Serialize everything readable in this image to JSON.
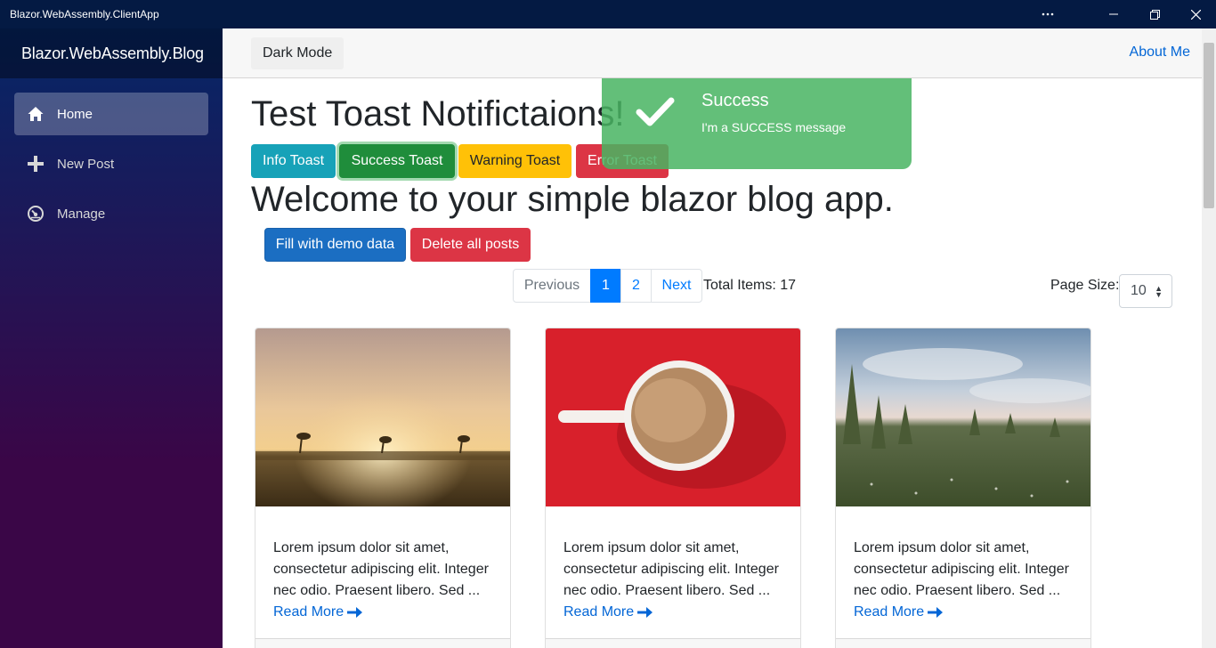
{
  "window": {
    "title": "Blazor.WebAssembly.ClientApp"
  },
  "sidebar": {
    "brand": "Blazor.WebAssembly.Blog",
    "items": [
      {
        "label": "Home",
        "icon": "home-icon",
        "active": true
      },
      {
        "label": "New Post",
        "icon": "plus-icon",
        "active": false
      },
      {
        "label": "Manage",
        "icon": "dashboard-icon",
        "active": false
      }
    ]
  },
  "top_row": {
    "dark_mode": "Dark Mode",
    "about_me": "About Me"
  },
  "main": {
    "toast_heading": "Test Toast Notifictaions!",
    "buttons": {
      "info": "Info Toast",
      "success": "Success Toast",
      "warning": "Warning Toast",
      "error": "Error Toast"
    },
    "welcome": "Welcome to your simple blazor blog app.",
    "fill_demo": "Fill with demo data",
    "delete_all": "Delete all posts",
    "pagination": {
      "previous": "Previous",
      "pages": [
        "1",
        "2"
      ],
      "current": "1",
      "next": "Next"
    },
    "total_items": "Total Items: 17",
    "page_size_label": "Page Size:",
    "page_size_value": "10"
  },
  "posts": [
    {
      "image": "sunset-field-photo",
      "excerpt": "Lorem ipsum dolor sit amet, consectetur adipiscing elit. Integer nec odio. Praesent libero. Sed ...",
      "read_more": "Read More"
    },
    {
      "image": "coffee-cup-photo",
      "excerpt": "Lorem ipsum dolor sit amet, consectetur adipiscing elit. Integer nec odio. Praesent libero. Sed ...",
      "read_more": "Read More"
    },
    {
      "image": "meadow-trees-photo",
      "excerpt": "Lorem ipsum dolor sit amet, consectetur adipiscing elit. Integer nec odio. Praesent libero. Sed ...",
      "read_more": "Read More"
    }
  ],
  "toast": {
    "heading": "Success",
    "message": "I'm a SUCCESS message",
    "icon": "checkmark-icon"
  },
  "colors": {
    "primary": "#1b6ec2",
    "link": "#0366d6",
    "success_toast": "#48b461",
    "info": "#17a2b8",
    "warning": "#ffc107",
    "danger": "#dc3545"
  }
}
